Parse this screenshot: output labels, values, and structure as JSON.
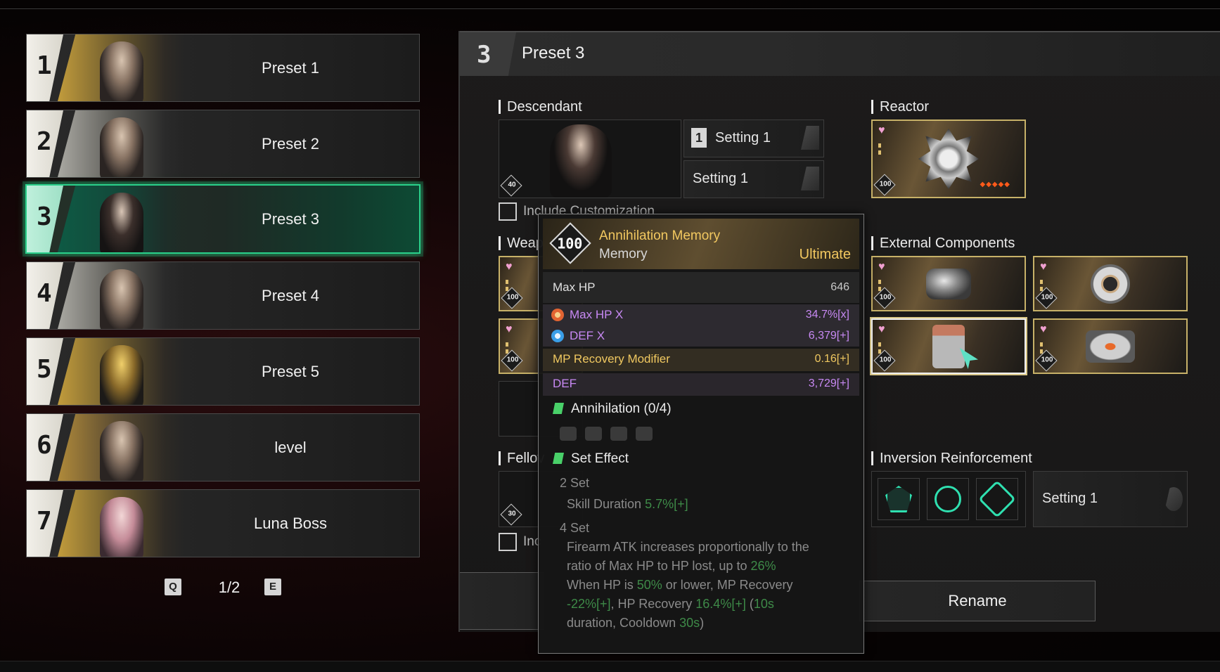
{
  "presets": [
    {
      "number": "1",
      "label": "Preset 1"
    },
    {
      "number": "2",
      "label": "Preset 2"
    },
    {
      "number": "3",
      "label": "Preset 3"
    },
    {
      "number": "4",
      "label": "Preset 4"
    },
    {
      "number": "5",
      "label": "Preset 5"
    },
    {
      "number": "6",
      "label": "level"
    },
    {
      "number": "7",
      "label": "Luna Boss"
    }
  ],
  "selected_preset": "3",
  "pager": {
    "prev_key": "Q",
    "page": "1/2",
    "next_key": "E"
  },
  "detail": {
    "number": "3",
    "title": "Preset 3",
    "descendant": {
      "section": "Descendant",
      "level": "40",
      "setting_top": {
        "badge": "1",
        "label": "Setting 1"
      },
      "setting_bottom": {
        "label": "Setting 1"
      },
      "include_customization": "Include Customization"
    },
    "reactor": {
      "section": "Reactor",
      "level": "100",
      "rank_dots": "◆◆◆◆◆"
    },
    "weapons": {
      "section": "Weap",
      "levels": [
        "100",
        "100"
      ]
    },
    "external_components": {
      "section": "External Components",
      "levels": [
        "100",
        "100",
        "100",
        "100"
      ]
    },
    "fellow": {
      "section": "Fellov",
      "level": "30",
      "include_label": "Inc"
    },
    "inversion": {
      "section": "Inversion Reinforcement",
      "setting_label": "Setting 1"
    },
    "rename_label": "Rename"
  },
  "tooltip": {
    "level": "100",
    "name": "Annihilation Memory",
    "type": "Memory",
    "rarity": "Ultimate",
    "base_stat": {
      "name": "Max HP",
      "value": "646"
    },
    "stats": [
      {
        "name": "Max HP X",
        "value": "34.7%[x]",
        "icon": "hp-icon"
      },
      {
        "name": "DEF X",
        "value": "6,379[+]",
        "icon": "def-icon"
      },
      {
        "name": "MP Recovery Modifier",
        "value": "0.16[+]"
      },
      {
        "name": "DEF",
        "value": "3,729[+]"
      }
    ],
    "set_name": "Annihilation (0/4)",
    "set_effect_title": "Set Effect",
    "two_set": {
      "title": "2 Set",
      "text": "Skill Duration",
      "value": "5.7%[+]"
    },
    "four_set": {
      "title": "4 Set",
      "line1": "Firearm ATK increases proportionally to the",
      "line2_pre": "ratio of Max HP to HP lost, up to",
      "line2_val": "26%",
      "line3_pre": "When HP is",
      "line3_val": "50%",
      "line3_post": "or lower, MP Recovery",
      "line4_val1": "-22%[+]",
      "line4_mid": ", HP Recovery",
      "line4_val2": "16.4%[+]",
      "line4_paren": "(",
      "line4_val3": "10s",
      "line5_pre": "duration, Cooldown",
      "line5_val": "30s",
      "line5_post": ")"
    }
  },
  "colors": {
    "selection": "#2ad08a",
    "rarity_gold": "#f2c860",
    "stat_purple": "#c889f4",
    "set_green": "#49d069"
  }
}
